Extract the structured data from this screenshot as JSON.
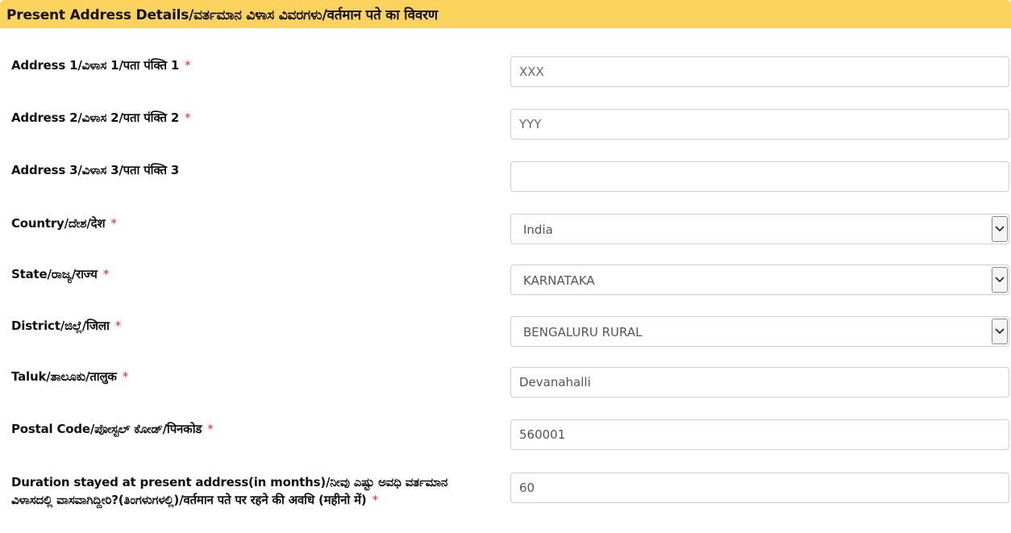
{
  "section": {
    "title": "Present Address Details/ವರ್ತಮಾನ ವಿಳಾಸ ವಿವರಗಳು/वर्तमान पते का विवरण"
  },
  "required_mark": "*",
  "fields": {
    "address1": {
      "label": "Address 1/ವಿಳಾಸ 1/पता पंक्ति 1",
      "placeholder": "XXX",
      "value": ""
    },
    "address2": {
      "label": "Address 2/ವಿಳಾಸ 2/पता पंक्ति 2",
      "placeholder": "YYY",
      "value": ""
    },
    "address3": {
      "label": "Address 3/ವಿಳಾಸ 3/पता पंक्ति 3",
      "placeholder": "",
      "value": ""
    },
    "country": {
      "label": "Country/ದೇಶ/देश",
      "selected": "India"
    },
    "state": {
      "label": "State/ರಾಜ್ಯ/राज्य",
      "selected": "KARNATAKA"
    },
    "district": {
      "label": "District/ಜಿಲ್ಲೆ/जिला",
      "selected": "BENGALURU RURAL"
    },
    "taluk": {
      "label": "Taluk/ತಾಲೂಕು/तालुक",
      "value": "Devanahalli"
    },
    "postal_code": {
      "label": "Postal Code/ಪೋಸ್ಟಲ್ ಕೋಡ್/पिनकोड",
      "value": "560001"
    },
    "duration": {
      "label": "Duration stayed at present address(in months)/ನೀವು ಎಷ್ಟು ಅವಧಿ ವರ್ತಮಾನ ವಿಳಾಸದಲ್ಲಿ ವಾಸವಾಗಿದ್ದೀರಿ?(ತಿಂಗಳುಗಳಲ್ಲಿ)/वर्तमान पते पर रहने की अवधि (महीनो में)",
      "value": "60"
    }
  },
  "colors": {
    "header_bg": "#fdd360",
    "required": "#d9302c",
    "input_border": "#cfcfcf",
    "input_text": "#555555"
  },
  "icons": {
    "dropdown": "chevron-down-icon"
  }
}
